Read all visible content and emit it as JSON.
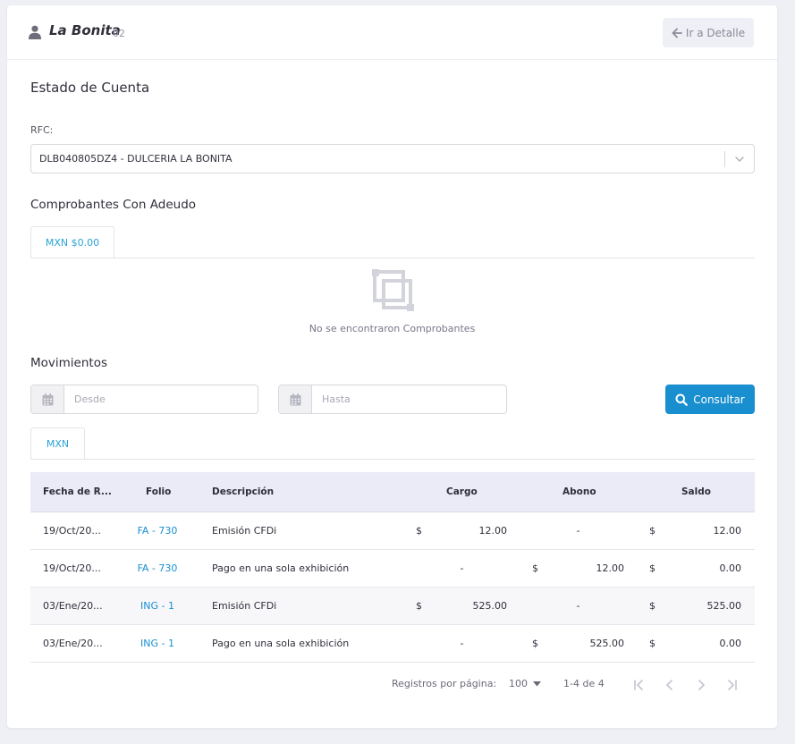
{
  "header": {
    "client_name": "La Bonita",
    "client_number": "02",
    "back_button": "Ir a Detalle"
  },
  "page_title": "Estado de Cuenta",
  "rfc": {
    "label": "RFC:",
    "value": "DLB040805DZ4 - DULCERIA LA BONITA"
  },
  "adeudo": {
    "title": "Comprobantes Con Adeudo",
    "tab": "MXN $0.00",
    "empty_message": "No se encontraron Comprobantes"
  },
  "movimientos": {
    "title": "Movimientos",
    "desde_placeholder": "Desde",
    "hasta_placeholder": "Hasta",
    "consultar_label": "Consultar",
    "tab": "MXN"
  },
  "table": {
    "columns": [
      "Fecha de R...",
      "Folio",
      "Descripción",
      "Cargo",
      "Abono",
      "Saldo"
    ],
    "rows": [
      {
        "fecha": "19/Oct/20...",
        "folio": "FA - 730",
        "descripcion": "Emisión CFDi",
        "cargo_sign": "$",
        "cargo": "12.00",
        "abono_sign": "",
        "abono": "-",
        "saldo_sign": "$",
        "saldo": "12.00"
      },
      {
        "fecha": "19/Oct/20...",
        "folio": "FA - 730",
        "descripcion": "Pago en una sola exhibición",
        "cargo_sign": "",
        "cargo": "-",
        "abono_sign": "$",
        "abono": "12.00",
        "saldo_sign": "$",
        "saldo": "0.00"
      },
      {
        "fecha": "03/Ene/20...",
        "folio": "ING - 1",
        "descripcion": "Emisión CFDi",
        "cargo_sign": "$",
        "cargo": "525.00",
        "abono_sign": "",
        "abono": "-",
        "saldo_sign": "$",
        "saldo": "525.00"
      },
      {
        "fecha": "03/Ene/20...",
        "folio": "ING - 1",
        "descripcion": "Pago en una sola exhibición",
        "cargo_sign": "",
        "cargo": "-",
        "abono_sign": "$",
        "abono": "525.00",
        "saldo_sign": "$",
        "saldo": "0.00"
      }
    ]
  },
  "pagination": {
    "per_page_label": "Registros por página:",
    "per_page_value": "100",
    "range": "1-4 de 4"
  },
  "colors": {
    "accent": "#1a8fd0",
    "tab_text": "#2aa3d5",
    "table_header_bg": "#ebebf7"
  },
  "icons": [
    "user-icon",
    "arrow-left-icon",
    "chevron-down-icon",
    "empty-box-icon",
    "calendar-icon",
    "search-icon",
    "first-page-icon",
    "prev-page-icon",
    "next-page-icon",
    "last-page-icon"
  ]
}
